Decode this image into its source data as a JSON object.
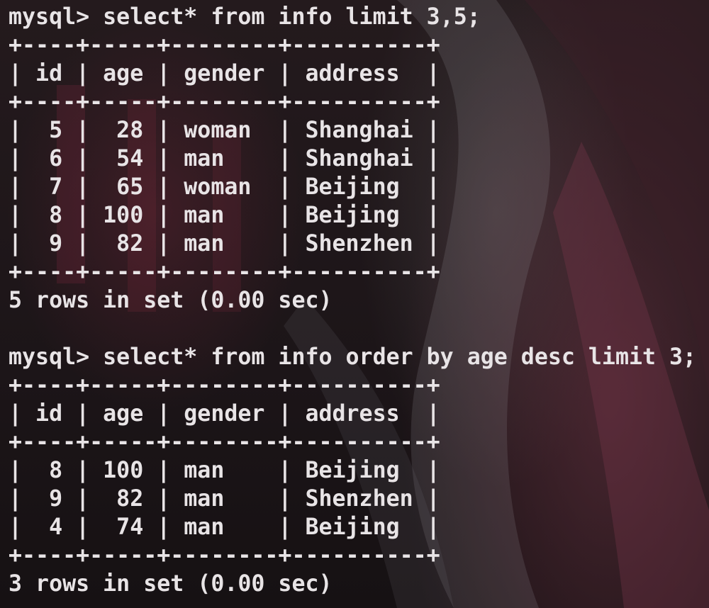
{
  "terminal": {
    "lines": [
      "mysql> select* from info limit 3,5;",
      "+----+-----+--------+----------+",
      "| id | age | gender | address  |",
      "+----+-----+--------+----------+",
      "|  5 |  28 | woman  | Shanghai |",
      "|  6 |  54 | man    | Shanghai |",
      "|  7 |  65 | woman  | Beijing  |",
      "|  8 | 100 | man    | Beijing  |",
      "|  9 |  82 | man    | Shenzhen |",
      "+----+-----+--------+----------+",
      "5 rows in set (0.00 sec)",
      "",
      "mysql> select* from info order by age desc limit 3;",
      "+----+-----+--------+----------+",
      "| id | age | gender | address  |",
      "+----+-----+--------+----------+",
      "|  8 | 100 | man    | Beijing  |",
      "|  9 |  82 | man    | Shenzhen |",
      "|  4 |  74 | man    | Beijing  |",
      "+----+-----+--------+----------+",
      "3 rows in set (0.00 sec)"
    ]
  }
}
